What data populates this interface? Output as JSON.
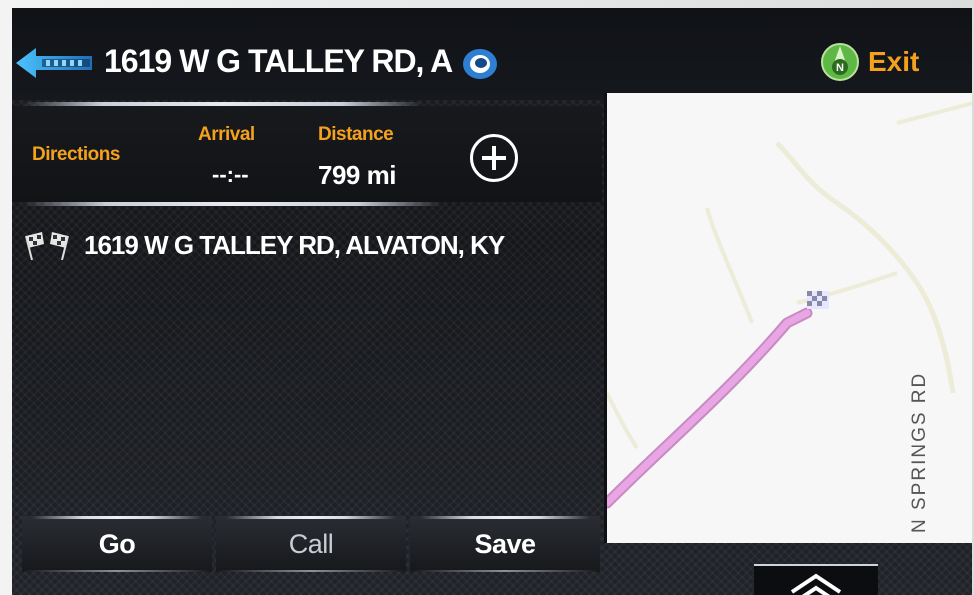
{
  "header": {
    "title": "1619 W G TALLEY RD, A",
    "exit_label": "Exit",
    "compass_letter": "N"
  },
  "info": {
    "directions_label": "Directions",
    "arrival_label": "Arrival",
    "arrival_value": "--:--",
    "distance_label": "Distance",
    "distance_value": "799 mi"
  },
  "destination": {
    "address": "1619 W G TALLEY RD, ALVATON, KY"
  },
  "map": {
    "road_label": "N SPRINGS RD",
    "route_color": "#e8a6e4",
    "road_color": "#ececd8"
  },
  "bottom_bar": {
    "go_label": "Go",
    "call_label": "Call",
    "save_label": "Save"
  },
  "colors": {
    "accent": "#f4a11e",
    "back_arrow": "#3aa7e6",
    "compass_green": "#5fb846"
  }
}
